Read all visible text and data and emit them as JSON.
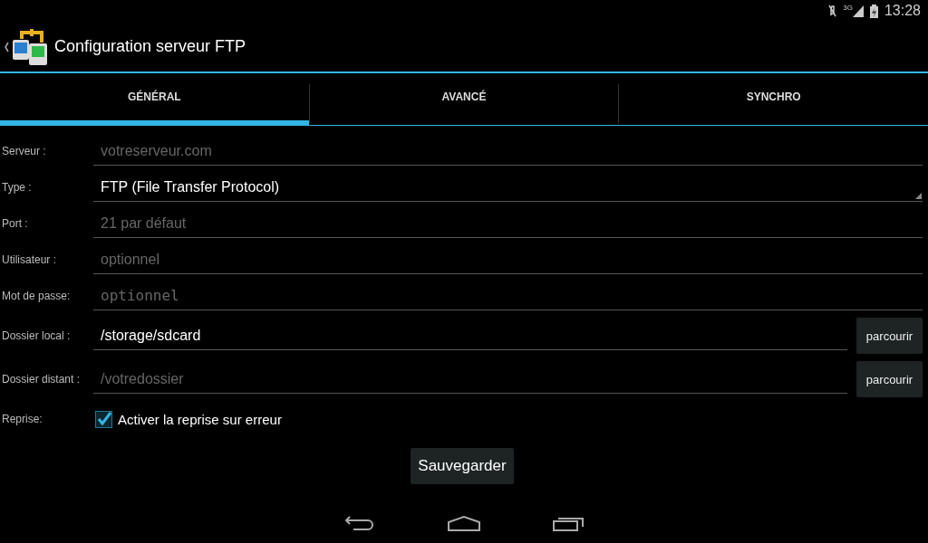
{
  "status_bar": {
    "time": "13:28",
    "network": "3G"
  },
  "action_bar": {
    "title": "Configuration serveur FTP"
  },
  "tabs": [
    {
      "label": "GÉNÉRAL",
      "selected": true
    },
    {
      "label": "AVANCÉ",
      "selected": false
    },
    {
      "label": "SYNCHRO",
      "selected": false
    }
  ],
  "form": [
    {
      "kind": "text",
      "label": "Serveur :",
      "placeholder": "votreserveur.com"
    },
    {
      "kind": "spinner",
      "label": "Type :",
      "value": "FTP (File Transfer Protocol)"
    },
    {
      "kind": "text",
      "label": "Port :",
      "placeholder": "21 par défaut"
    },
    {
      "kind": "text",
      "label": "Utilisateur :",
      "placeholder": "optionnel"
    },
    {
      "kind": "password",
      "label": "Mot de passe:",
      "placeholder": "optionnel"
    },
    {
      "kind": "folder",
      "label": "Dossier local :",
      "value": "/storage/sdcard",
      "button": "parcourir"
    },
    {
      "kind": "folder",
      "label": "Dossier distant :",
      "placeholder": "/votredossier",
      "button": "parcourir"
    },
    {
      "kind": "checkbox",
      "label": "Reprise:",
      "text": "Activer la reprise sur erreur",
      "checked": true
    }
  ],
  "save_button": "Sauvegarder"
}
